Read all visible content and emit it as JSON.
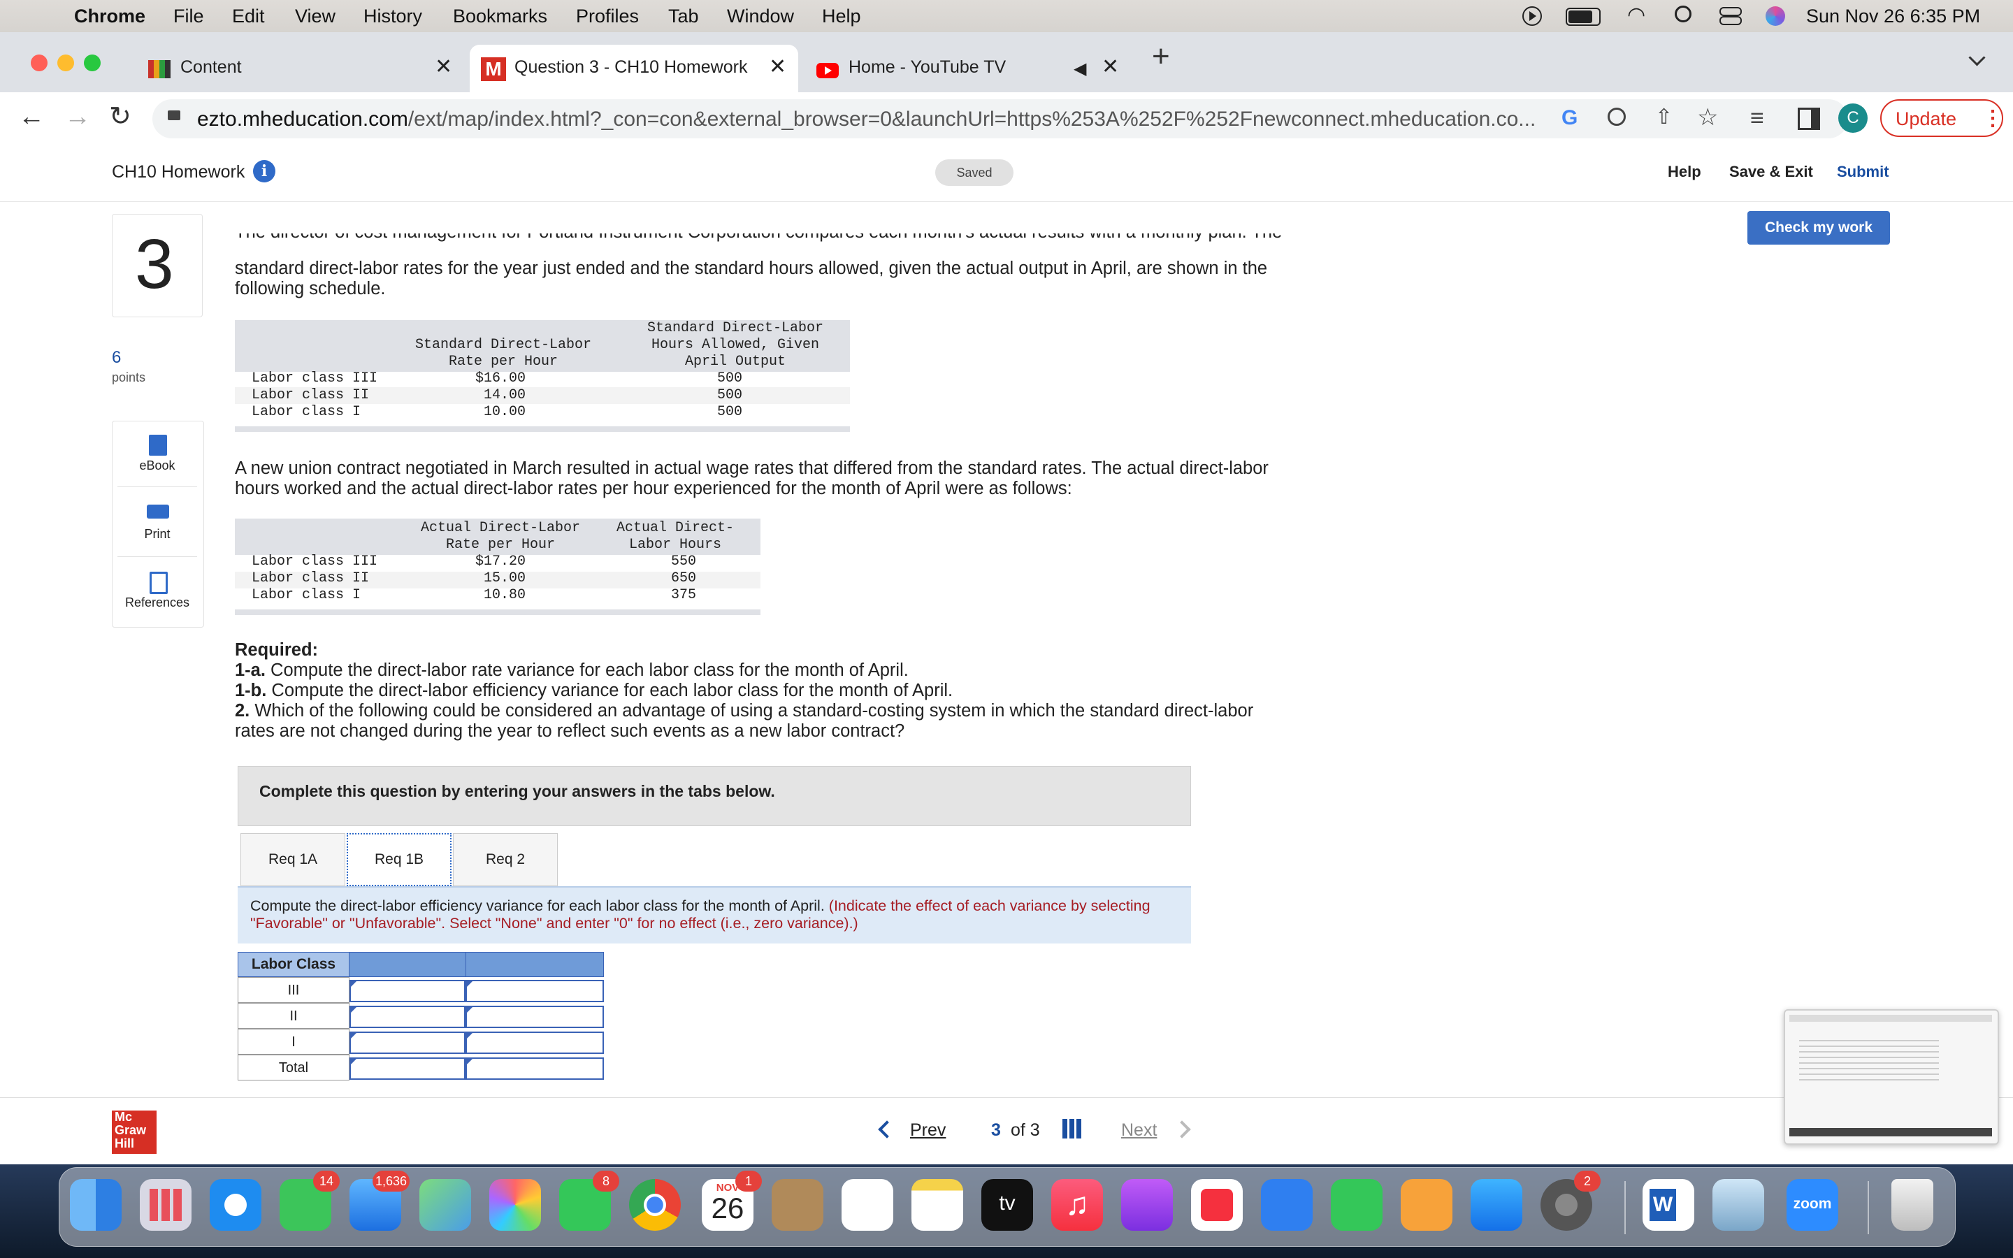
{
  "menubar": {
    "app": "Chrome",
    "items": [
      "File",
      "Edit",
      "View",
      "History",
      "Bookmarks",
      "Profiles",
      "Tab",
      "Window",
      "Help"
    ],
    "clock": "Sun Nov 26  6:35 PM"
  },
  "tabs": [
    {
      "label": "Content"
    },
    {
      "label": "Question 3 - CH10 Homework"
    },
    {
      "label": "Home - YouTube TV"
    }
  ],
  "address": {
    "host": "ezto.mheducation.com",
    "path": "/ext/map/index.html?_con=con&external_browser=0&launchUrl=https%253A%252F%252Fnewconnect.mheducation.co...",
    "profile_initial": "C",
    "update_label": "Update"
  },
  "app_header": {
    "title": "CH10 Homework",
    "saved": "Saved",
    "help": "Help",
    "save_exit": "Save & Exit",
    "submit": "Submit"
  },
  "check_work": "Check my work",
  "question": {
    "number": "3",
    "points": "6",
    "points_label": "points",
    "cut_line": "The director of cost management for Portland Instrument Corporation compares each month's actual results with a monthly plan. The",
    "intro": "standard direct-labor rates for the year just ended and the standard hours allowed, given the actual output in April, are shown in the following schedule.",
    "para2": "A new union contract negotiated in March resulted in actual wage rates that differed from the standard rates. The actual direct-labor hours worked and the actual direct-labor rates per hour experienced for the month of April were as follows:",
    "required_label": "Required:",
    "req_1a_tag": "1-a.",
    "req_1a": " Compute the direct-labor rate variance for each labor class for the month of April.",
    "req_1b_tag": "1-b.",
    "req_1b": " Compute the direct-labor efficiency variance for each labor class for the month of April.",
    "req_2_tag": "2.",
    "req_2": " Which of the following could be considered an advantage of using a standard-costing system in which the standard direct-labor rates are not changed during the year to reflect such events as a new labor contract?"
  },
  "table1": {
    "col1": [
      "Standard Direct-Labor",
      "Rate per Hour"
    ],
    "col2": [
      "Standard Direct-Labor",
      "Hours Allowed, Given",
      "April Output"
    ],
    "rows": [
      {
        "label": "Labor class III",
        "rate": "$16.00",
        "hours": "500"
      },
      {
        "label": "Labor class II",
        "rate": "14.00",
        "hours": "500"
      },
      {
        "label": "Labor class I",
        "rate": "10.00",
        "hours": "500"
      }
    ]
  },
  "table2": {
    "col1": [
      "Actual Direct-Labor",
      "Rate per Hour"
    ],
    "col2": [
      "Actual Direct-",
      "Labor Hours"
    ],
    "rows": [
      {
        "label": "Labor class III",
        "rate": "$17.20",
        "hours": "550"
      },
      {
        "label": "Labor class II",
        "rate": "15.00",
        "hours": "650"
      },
      {
        "label": "Labor class I",
        "rate": "10.80",
        "hours": "375"
      }
    ]
  },
  "sidebar": {
    "ebook": "eBook",
    "print": "Print",
    "references": "References"
  },
  "tabs_box": {
    "instruction": "Complete this question by entering your answers in the tabs below.",
    "tabs": [
      "Req 1A",
      "Req 1B",
      "Req 2"
    ],
    "active": "Req 1B",
    "task": "Compute the direct-labor efficiency variance for each labor class for the month of April.",
    "hint": "(Indicate the effect of each variance by selecting \"Favorable\" or \"Unfavorable\". Select \"None\" and enter \"0\" for no effect (i.e., zero variance).)"
  },
  "answer_table": {
    "header": "Labor Class",
    "rows": [
      "III",
      "II",
      "I",
      "Total"
    ]
  },
  "footer": {
    "logo": [
      "Mc",
      "Graw",
      "Hill"
    ],
    "prev": "Prev",
    "page_current": "3",
    "page_of": "of 3",
    "next": "Next"
  },
  "dock": {
    "messages_badge": "14",
    "mail_badge": "1,636",
    "facetime_badge": "8",
    "calendar_month": "NOV",
    "calendar_day": "26",
    "calendar_badge": "1",
    "settings_badge": "2",
    "tv_label": "tv",
    "word_label": "W",
    "zoom_label": "zoom"
  }
}
